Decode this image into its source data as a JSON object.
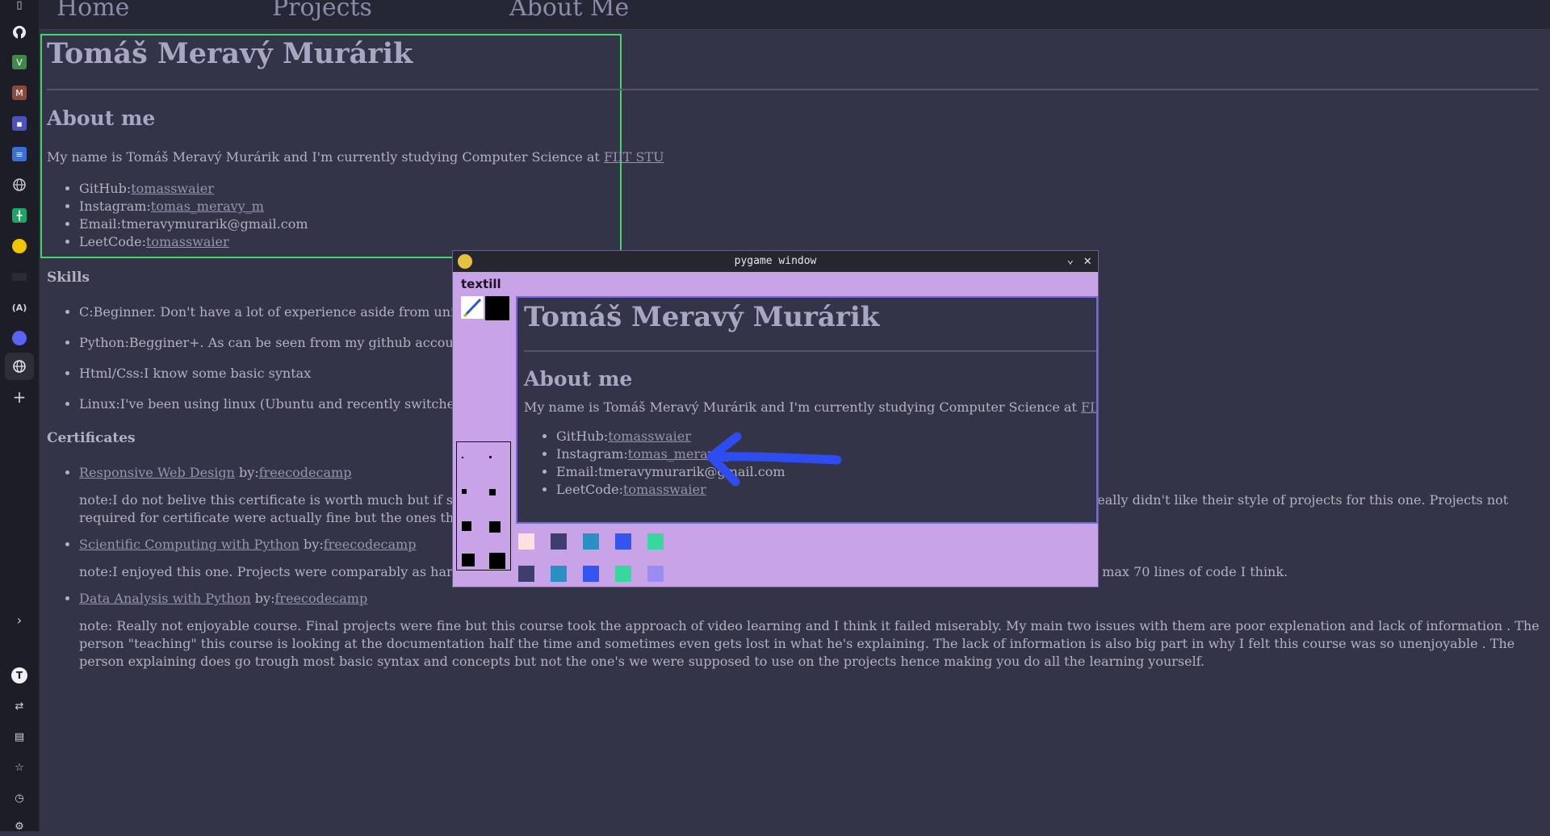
{
  "browser_sidebar": {
    "icons": [
      "browser-menu-icon",
      "github-icon",
      "v-app-icon",
      "m-app-icon",
      "teams-icon",
      "docs-icon",
      "globe-icon",
      "sheets-icon",
      "yellow-circle-icon",
      "dark-app-icon",
      "ai-icon",
      "discord-icon",
      "globe-active-icon",
      "plus-icon",
      "expand-icon",
      "profile-icon",
      "swap-icon",
      "sidebar-toggle-icon",
      "star-icon",
      "history-icon",
      "settings-icon"
    ],
    "profile_letter": "T",
    "v_letter": "V",
    "m_letter": "M"
  },
  "nav": {
    "items": [
      "Home",
      "Projects",
      "About Me"
    ]
  },
  "page": {
    "name": "Tomáš Meravý Murárik",
    "about_heading": "About me",
    "about_text": "My name is Tomáš Meravý Murárik and I'm currently studying Computer Science at ",
    "about_link": "FIIT STU",
    "contacts": [
      {
        "label": "GitHub:",
        "value": "tomasswaier"
      },
      {
        "label": "Instagram:",
        "value": "tomas_meravy_m"
      },
      {
        "label": "Email:",
        "value": "tmeravymurarik@gmail.com"
      },
      {
        "label": "LeetCode:",
        "value": "tomasswaier"
      }
    ],
    "skills_heading": "Skills",
    "skills": [
      "C:Beginner. Don't have a lot of experience aside from uni clas",
      "Python:Begginer+. As can be seen from my github account I r",
      "Html/Css:I know some basic syntax",
      "Linux:I've been using linux (Ubuntu and recently switched to"
    ],
    "certs_heading": "Certificates",
    "certs": [
      {
        "title": "Responsive Web Design",
        "by": " by:",
        "issuer": "freecodecamp",
        "note_a": "note:I do not belive this certificate is worth much but if some",
        "note_b": "I really didn't like their style of projects for this one. Projects not",
        "note_c": "required for certificate were actually fine but the ones that a"
      },
      {
        "title": "Scientific Computing with Python",
        "by": " by:",
        "issuer": "freecodecamp",
        "note_a": "note:I enjoyed this one. Projects were comparably as hard as",
        "note_b": "to do were max 70 lines of code I think."
      },
      {
        "title": "Data Analysis with Python",
        "by": " by:",
        "issuer": "freecodecamp",
        "note": "note: Really not enjoyable course. Final projects were fine but this course took the approach of video learning and I think it failed miserably. My main two issues with them are poor explenation and lack of information . The person \"teaching\" this course is looking at the documentation half the time and sometimes even gets lost in what he's explaining. The lack of information is also big part in why I felt this course was so unenjoyable . The person explaining does go trough most basic syntax and concepts but not the one's we were supposed to use on the projects hence making you do all the learning yourself."
      }
    ]
  },
  "pygame": {
    "window_title": "pygame window",
    "app_name": "textill",
    "canvas": {
      "name": "Tomáš Meravý Murárik",
      "about_heading": "About me",
      "about_text": "My name is Tomáš Meravý Murárik and I'm currently studying Computer Science at ",
      "about_link": "FIIT STU",
      "contacts": [
        {
          "label": "GitHub:",
          "value": "tomasswaier"
        },
        {
          "label": "Instagram:",
          "value": "tomas_meravy_"
        },
        {
          "label": "Email:",
          "value": "tmeravymurarik@gmail.com"
        },
        {
          "label": "LeetCode:",
          "value": "tomasswaier"
        }
      ],
      "stroke_color": "#2f4cf0"
    },
    "palette_row1": [
      "#fde0e0",
      "#3d3d6e",
      "#2b8fc4",
      "#3555f0",
      "#3ad6a0"
    ],
    "palette_row2": [
      "#3d3d6e",
      "#2b8fc4",
      "#3555f0",
      "#3ad6a0",
      "#9a8cf0"
    ],
    "accent": "#c9a3e8"
  },
  "colors": {
    "highlight_box": "#3fd66a",
    "page_bg": "#333447"
  }
}
